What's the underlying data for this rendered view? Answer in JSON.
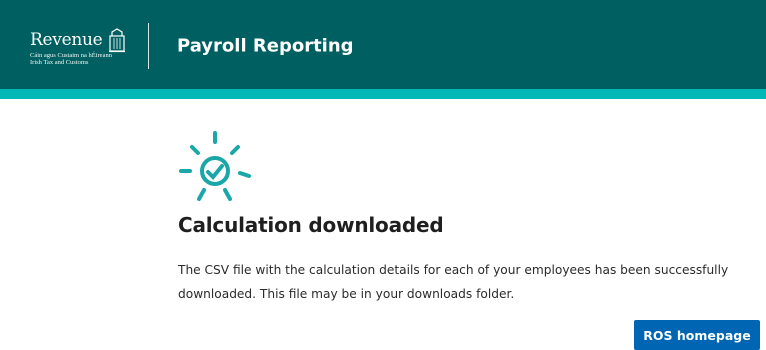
{
  "header": {
    "logo": {
      "word": "Revenue",
      "subtitle_line1": "Cáin agus Custaim na hÉireann",
      "subtitle_line2": "Irish Tax and Customs",
      "icon": "harp-icon"
    },
    "app_title": "Payroll Reporting"
  },
  "main": {
    "status_icon": "sun-check-icon",
    "heading": "Calculation downloaded",
    "message": "The CSV file with the calculation details for each of your employees has been successfully downloaded. This file may be in your downloads folder.",
    "primary_button_label": "ROS homepage"
  },
  "colors": {
    "header_bg": "#005f61",
    "accent_bar": "#00b8b6",
    "icon_teal": "#1aa7a8",
    "button_blue": "#0066b3"
  }
}
